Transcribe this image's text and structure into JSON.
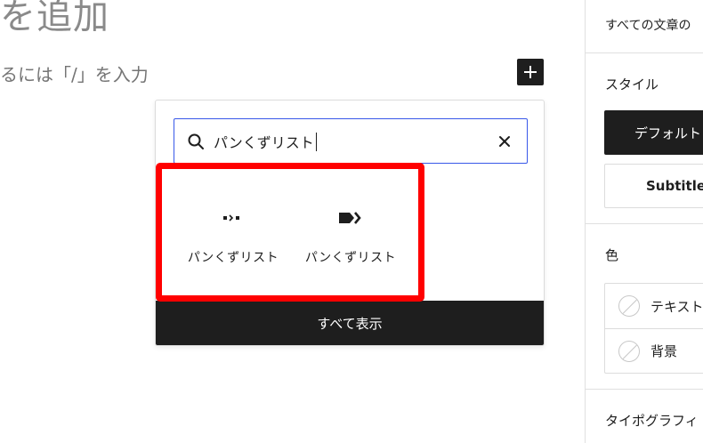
{
  "editor": {
    "heading_fragment": "を追加",
    "hint_fragment": "るには「/」を入力",
    "add_block_label": "+"
  },
  "inserter": {
    "search_value": "パンくずリスト",
    "results": [
      {
        "label": "パンくずリスト",
        "icon": "breadcrumb-dots-icon"
      },
      {
        "label": "パンくずリスト",
        "icon": "breadcrumb-arrows-icon"
      }
    ],
    "browse_all_label": "すべて表示"
  },
  "sidebar": {
    "description_fragment": "すべての文章の",
    "style_heading": "スタイル",
    "styles": [
      {
        "label": "デフォルト",
        "selected": true
      },
      {
        "label": "Subtitle",
        "selected": false
      }
    ],
    "color_heading": "色",
    "colors": [
      {
        "label": "テキスト"
      },
      {
        "label": "背景"
      }
    ],
    "typography_heading": "タイポグラフィ"
  },
  "colors": {
    "accent": "#3858e9",
    "dark": "#1e1e1e",
    "highlight": "#ff0000"
  }
}
